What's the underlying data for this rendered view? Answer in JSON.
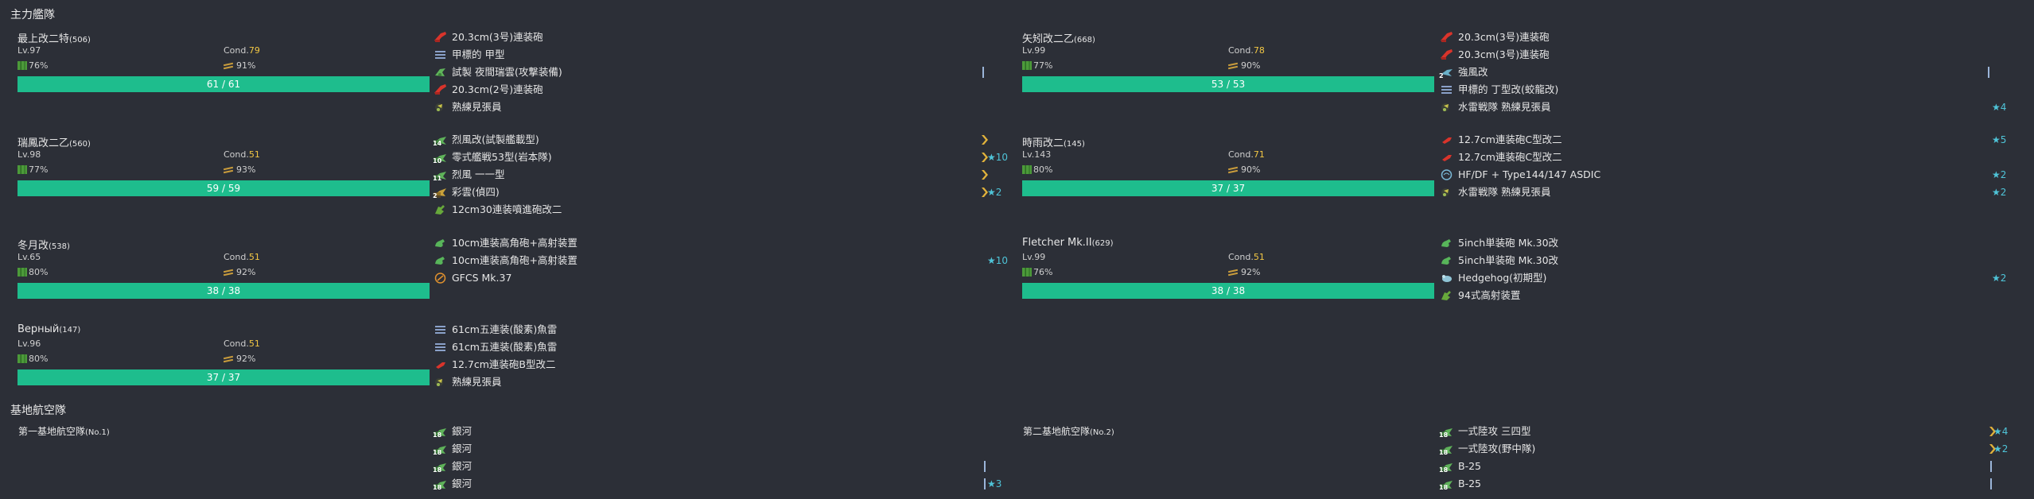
{
  "sections": {
    "main_fleet": "主力艦隊",
    "lbas": "基地航空隊"
  },
  "ships": [
    {
      "name": "最上改二特",
      "id": "(506)",
      "lv": "Lv.97",
      "cond_label": "Cond.",
      "cond": "79",
      "fuel": "76%",
      "ammo": "91%",
      "hp": "61 / 61",
      "equips": [
        {
          "icon": "main-gun-red-icon",
          "label": "20.3cm(3号)連装砲",
          "prof": "",
          "star": ""
        },
        {
          "icon": "radar-icon",
          "label": "甲標的 甲型",
          "prof": "",
          "star": ""
        },
        {
          "icon": "seaplane-bomber-icon",
          "label": "試製 夜間瑞雲(攻撃装備)",
          "prof": "|",
          "star": ""
        },
        {
          "icon": "main-gun-red-icon",
          "label": "20.3cm(2号)連装砲",
          "prof": "",
          "star": ""
        },
        {
          "icon": "lookout-icon",
          "label": "熟練見張員",
          "prof": "",
          "star": ""
        }
      ]
    },
    {
      "name": "矢矧改二乙",
      "id": "(668)",
      "lv": "Lv.99",
      "cond_label": "Cond.",
      "cond": "78",
      "fuel": "77%",
      "ammo": "90%",
      "hp": "53 / 53",
      "equips": [
        {
          "icon": "main-gun-red-icon",
          "label": "20.3cm(3号)連装砲",
          "prof": "",
          "star": ""
        },
        {
          "icon": "main-gun-red-icon",
          "label": "20.3cm(3号)連装砲",
          "prof": "",
          "star": ""
        },
        {
          "icon": "seaplane-icon",
          "label": "強風改",
          "prof": "|",
          "star": "",
          "count": "2"
        },
        {
          "icon": "radar-icon",
          "label": "甲標的 丁型改(蛟龍改)",
          "prof": "",
          "star": ""
        },
        {
          "icon": "lookout-icon",
          "label": "水雷戦隊 熟練見張員",
          "prof": "",
          "star": "★4"
        }
      ]
    },
    {
      "name": "瑞鳳改二乙",
      "id": "(560)",
      "lv": "Lv.98",
      "cond_label": "Cond.",
      "cond": "51",
      "fuel": "77%",
      "ammo": "93%",
      "hp": "59 / 59",
      "equips": [
        {
          "icon": "fighter-icon",
          "label": "烈風改(試製艦載型)",
          "prof": "»",
          "star": "",
          "count": "14"
        },
        {
          "icon": "fighter-icon",
          "label": "零式艦戦53型(岩本隊)",
          "prof": "»",
          "star": "★10",
          "count": "10"
        },
        {
          "icon": "fighter-icon",
          "label": "烈風 一一型",
          "prof": "»",
          "star": "",
          "count": "11"
        },
        {
          "icon": "recon-icon",
          "label": "彩雲(偵四)",
          "prof": "»",
          "star": "★2",
          "count": "2"
        },
        {
          "icon": "aa-gun-icon",
          "label": "12cm30連装噴進砲改二",
          "prof": "",
          "star": ""
        }
      ]
    },
    {
      "name": "時雨改二",
      "id": "(145)",
      "lv": "Lv.143",
      "cond_label": "Cond.",
      "cond": "71",
      "fuel": "80%",
      "ammo": "90%",
      "hp": "37 / 37",
      "equips": [
        {
          "icon": "small-gun-red-icon",
          "label": "12.7cm連装砲C型改二",
          "prof": "",
          "star": "★5"
        },
        {
          "icon": "small-gun-red-icon",
          "label": "12.7cm連装砲C型改二",
          "prof": "",
          "star": ""
        },
        {
          "icon": "sonar-icon",
          "label": "HF/DF + Type144/147 ASDIC",
          "prof": "",
          "star": "★2"
        },
        {
          "icon": "lookout-icon",
          "label": "水雷戦隊 熟練見張員",
          "prof": "",
          "star": "★2"
        }
      ]
    },
    {
      "name": "冬月改",
      "id": "(538)",
      "lv": "Lv.65",
      "cond_label": "Cond.",
      "cond": "51",
      "fuel": "80%",
      "ammo": "92%",
      "hp": "38 / 38",
      "equips": [
        {
          "icon": "hi-angle-gun-icon",
          "label": "10cm連装高角砲+高射装置",
          "prof": "",
          "star": ""
        },
        {
          "icon": "hi-angle-gun-icon",
          "label": "10cm連装高角砲+高射装置",
          "prof": "",
          "star": "★10"
        },
        {
          "icon": "aa-fire-director-icon",
          "label": "GFCS Mk.37",
          "prof": "",
          "star": ""
        }
      ]
    },
    {
      "name": "Fletcher Mk.II",
      "id": "(629)",
      "lv": "Lv.99",
      "cond_label": "Cond.",
      "cond": "51",
      "fuel": "76%",
      "ammo": "92%",
      "hp": "38 / 38",
      "equips": [
        {
          "icon": "hi-angle-gun-icon",
          "label": "5inch単装砲 Mk.30改",
          "prof": "",
          "star": ""
        },
        {
          "icon": "hi-angle-gun-icon",
          "label": "5inch単装砲 Mk.30改",
          "prof": "",
          "star": ""
        },
        {
          "icon": "depth-charge-icon",
          "label": "Hedgehog(初期型)",
          "prof": "",
          "star": "★2"
        },
        {
          "icon": "aa-gun-icon",
          "label": "94式高射装置",
          "prof": "",
          "star": ""
        }
      ]
    },
    {
      "name": "Верный",
      "id": "(147)",
      "lv": "Lv.96",
      "cond_label": "Cond.",
      "cond": "51",
      "fuel": "80%",
      "ammo": "92%",
      "hp": "37 / 37",
      "equips": [
        {
          "icon": "torpedo-icon",
          "label": "61cm五連装(酸素)魚雷",
          "prof": "",
          "star": ""
        },
        {
          "icon": "torpedo-icon",
          "label": "61cm五連装(酸素)魚雷",
          "prof": "",
          "star": ""
        },
        {
          "icon": "small-gun-red-icon",
          "label": "12.7cm連装砲B型改二",
          "prof": "",
          "star": ""
        },
        {
          "icon": "lookout-icon",
          "label": "熟練見張員",
          "prof": "",
          "star": ""
        }
      ]
    }
  ],
  "lbas": [
    {
      "name": "第一基地航空隊",
      "no": "(No.1)",
      "equips": [
        {
          "icon": "land-bomber-icon",
          "label": "銀河",
          "prof": "",
          "star": "",
          "count": "18"
        },
        {
          "icon": "land-bomber-icon",
          "label": "銀河",
          "prof": "",
          "star": "",
          "count": "18"
        },
        {
          "icon": "land-bomber-icon",
          "label": "銀河",
          "prof": "|",
          "star": "",
          "count": "18"
        },
        {
          "icon": "land-bomber-icon",
          "label": "銀河",
          "prof": "|",
          "star": "★3",
          "count": "18"
        }
      ]
    },
    {
      "name": "第二基地航空隊",
      "no": "(No.2)",
      "equips": [
        {
          "icon": "land-bomber-icon",
          "label": "一式陸攻 三四型",
          "prof": "»",
          "star": "★4",
          "count": "18"
        },
        {
          "icon": "land-bomber-icon",
          "label": "一式陸攻(野中隊)",
          "prof": "»",
          "star": "★2",
          "count": "18"
        },
        {
          "icon": "land-bomber-icon",
          "label": "B-25",
          "prof": "|",
          "star": "",
          "count": "18"
        },
        {
          "icon": "land-bomber-icon",
          "label": "B-25",
          "prof": "|",
          "star": "",
          "count": "18"
        }
      ]
    }
  ]
}
